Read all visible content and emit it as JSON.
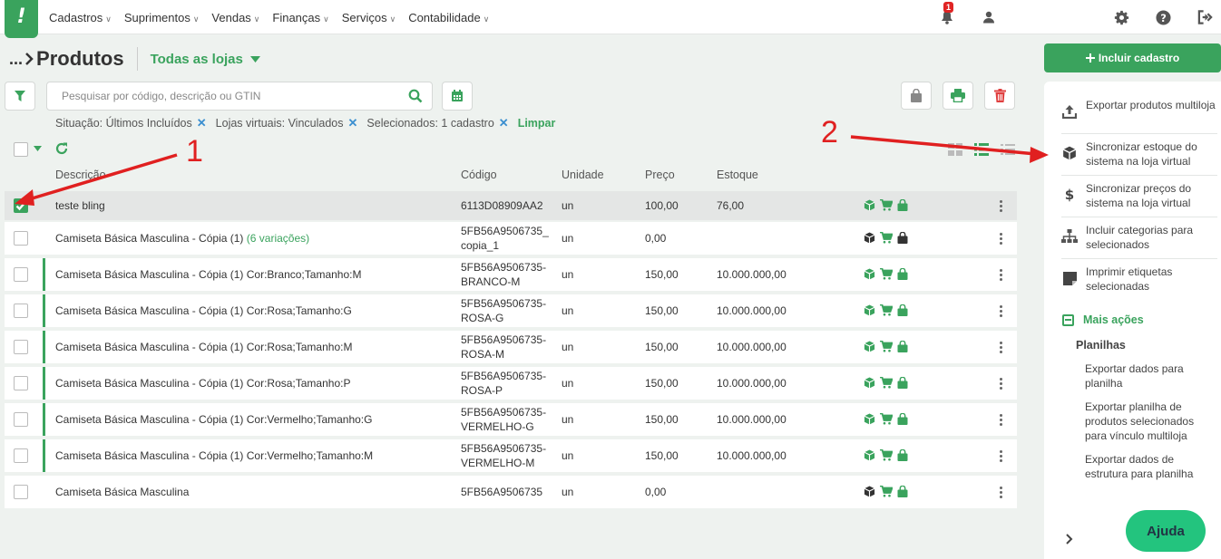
{
  "app": {
    "logo_glyph": "!",
    "accent_color": "#3aa35d"
  },
  "nav": {
    "items": [
      "Cadastros",
      "Suprimentos",
      "Vendas",
      "Finanças",
      "Serviços",
      "Contabilidade"
    ],
    "notification_count": "1",
    "icons": [
      "bell-icon",
      "user-icon",
      "gear-icon",
      "help-icon",
      "logout-icon"
    ]
  },
  "breadcrumb": {
    "ellipsis": "...",
    "title": "Produtos",
    "store_selector": "Todas as lojas"
  },
  "search": {
    "placeholder": "Pesquisar por código, descrição ou GTIN"
  },
  "filters": {
    "chips": [
      "Situação: Últimos Incluídos",
      "Lojas virtuais: Vinculados",
      "Selecionados: 1 cadastro"
    ],
    "clear": "Limpar"
  },
  "table": {
    "columns": {
      "description": "Descrição",
      "code": "Código",
      "unit": "Unidade",
      "price": "Preço",
      "stock": "Estoque"
    },
    "rows": [
      {
        "selected": true,
        "variation_child": false,
        "description": "teste bling",
        "variations": "",
        "code1": "6113D08909AA2",
        "code2": "",
        "unit": "un",
        "price": "100,00",
        "stock": "76,00",
        "box_icon_color": "#3aa35d",
        "bag_icon_color": "#3aa35d"
      },
      {
        "selected": false,
        "variation_child": false,
        "description": "Camiseta Básica Masculina - Cópia (1)",
        "variations": "(6 variações)",
        "code1": "5FB56A9506735_",
        "code2": "copia_1",
        "unit": "un",
        "price": "0,00",
        "stock": "",
        "box_icon_color": "#333333",
        "bag_icon_color": "#333333"
      },
      {
        "selected": false,
        "variation_child": true,
        "description": "Camiseta Básica Masculina - Cópia (1) Cor:Branco;Tamanho:M",
        "variations": "",
        "code1": "5FB56A9506735-",
        "code2": "BRANCO-M",
        "unit": "un",
        "price": "150,00",
        "stock": "10.000.000,00",
        "box_icon_color": "#3aa35d",
        "bag_icon_color": "#3aa35d"
      },
      {
        "selected": false,
        "variation_child": true,
        "description": "Camiseta Básica Masculina - Cópia (1) Cor:Rosa;Tamanho:G",
        "variations": "",
        "code1": "5FB56A9506735-",
        "code2": "ROSA-G",
        "unit": "un",
        "price": "150,00",
        "stock": "10.000.000,00",
        "box_icon_color": "#3aa35d",
        "bag_icon_color": "#3aa35d"
      },
      {
        "selected": false,
        "variation_child": true,
        "description": "Camiseta Básica Masculina - Cópia (1) Cor:Rosa;Tamanho:M",
        "variations": "",
        "code1": "5FB56A9506735-",
        "code2": "ROSA-M",
        "unit": "un",
        "price": "150,00",
        "stock": "10.000.000,00",
        "box_icon_color": "#3aa35d",
        "bag_icon_color": "#3aa35d"
      },
      {
        "selected": false,
        "variation_child": true,
        "description": "Camiseta Básica Masculina - Cópia (1) Cor:Rosa;Tamanho:P",
        "variations": "",
        "code1": "5FB56A9506735-",
        "code2": "ROSA-P",
        "unit": "un",
        "price": "150,00",
        "stock": "10.000.000,00",
        "box_icon_color": "#3aa35d",
        "bag_icon_color": "#3aa35d"
      },
      {
        "selected": false,
        "variation_child": true,
        "description": "Camiseta Básica Masculina - Cópia (1) Cor:Vermelho;Tamanho:G",
        "variations": "",
        "code1": "5FB56A9506735-",
        "code2": "VERMELHO-G",
        "unit": "un",
        "price": "150,00",
        "stock": "10.000.000,00",
        "box_icon_color": "#3aa35d",
        "bag_icon_color": "#3aa35d"
      },
      {
        "selected": false,
        "variation_child": true,
        "description": "Camiseta Básica Masculina - Cópia (1) Cor:Vermelho;Tamanho:M",
        "variations": "",
        "code1": "5FB56A9506735-",
        "code2": "VERMELHO-M",
        "unit": "un",
        "price": "150,00",
        "stock": "10.000.000,00",
        "box_icon_color": "#3aa35d",
        "bag_icon_color": "#3aa35d"
      },
      {
        "selected": false,
        "variation_child": false,
        "description": "Camiseta Básica Masculina",
        "variations": "",
        "code1": "5FB56A9506735",
        "code2": "",
        "unit": "un",
        "price": "0,00",
        "stock": "",
        "box_icon_color": "#333333",
        "bag_icon_color": "#3aa35d"
      }
    ]
  },
  "sidebar": {
    "include_button": "Incluir cadastro",
    "actions": [
      {
        "icon": "upload-icon",
        "label": "Exportar produtos multiloja"
      },
      {
        "icon": "box-icon",
        "label": "Sincronizar estoque do sistema na loja virtual"
      },
      {
        "icon": "dollar-icon",
        "label": "Sincronizar preços do sistema na loja virtual"
      },
      {
        "icon": "sitemap-icon",
        "label": "Incluir categorias para selecionados"
      },
      {
        "icon": "label-icon",
        "label": "Imprimir etiquetas selecionadas"
      }
    ],
    "more_actions": "Mais ações",
    "spreadsheets_title": "Planilhas",
    "spreadsheets": [
      "Exportar dados para planilha",
      "Exportar planilha de produtos selecionados para vínculo multiloja",
      "Exportar dados de estrutura para planilha"
    ],
    "help_button": "Ajuda"
  },
  "annotations": {
    "label1": "1",
    "label2": "2",
    "color": "#e02020"
  }
}
